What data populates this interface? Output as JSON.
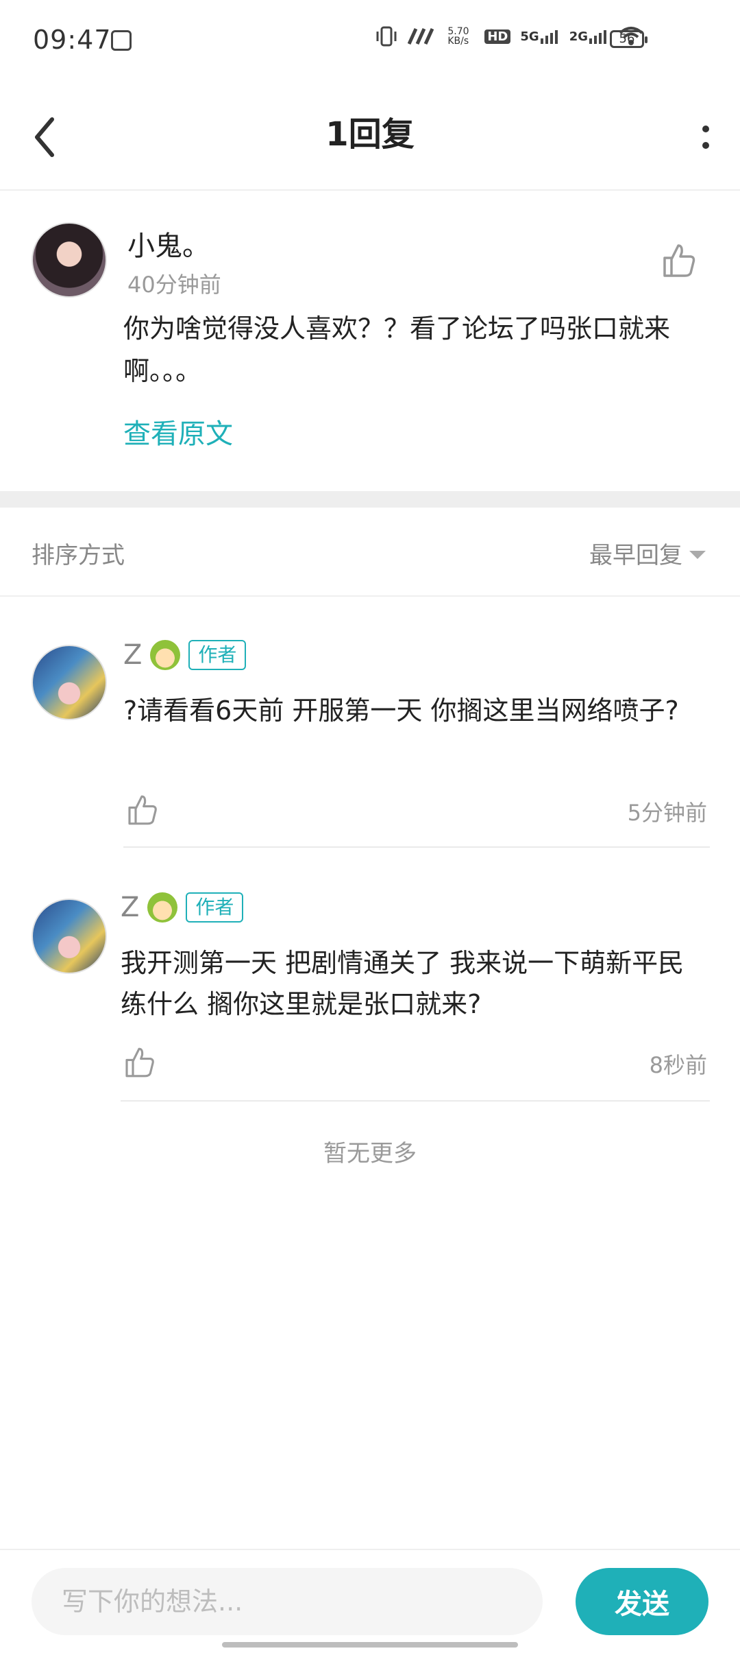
{
  "status_bar": {
    "time": "09:47",
    "net_speed": "5.70 KB/s",
    "net_labels": [
      "HD",
      "5G",
      "2G"
    ],
    "battery": "56"
  },
  "header": {
    "title": "1回复",
    "back_icon": "chevron-left-icon",
    "more_icon": "more-vertical-icon"
  },
  "original_comment": {
    "author": "小鬼。",
    "time": "40分钟前",
    "content": "你为啥觉得没人喜欢？？看了论坛了吗张口就来啊。。。",
    "view_original": "查看原文"
  },
  "sort": {
    "label": "排序方式",
    "selected": "最早回复"
  },
  "replies": [
    {
      "author": "Z",
      "badge": "作者",
      "content": "?请看看6天前 开服第一天 你搁这里当网络喷子?",
      "time": "5分钟前"
    },
    {
      "author": "Z",
      "badge": "作者",
      "content": "我开测第一天 把剧情通关了  我来说一下萌新平民练什么 搁你这里就是张口就来?",
      "time": "8秒前"
    }
  ],
  "no_more": "暂无更多",
  "composer": {
    "placeholder": "写下你的想法...",
    "send_label": "发送"
  },
  "colors": {
    "accent": "#1fb0b8",
    "text": "#222222",
    "muted": "#9a9a9a"
  }
}
